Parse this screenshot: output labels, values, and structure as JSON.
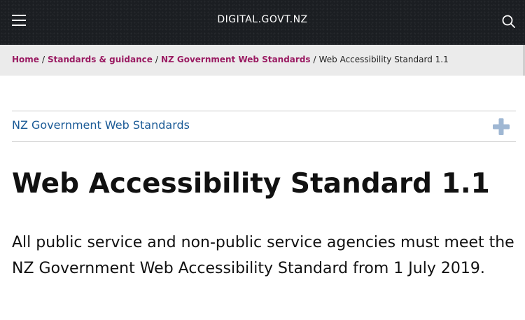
{
  "header": {
    "site_title": "DIGITAL.GOVT.NZ",
    "menu_icon": "hamburger-menu-icon",
    "search_icon": "search-icon"
  },
  "breadcrumb": {
    "items": [
      {
        "label": "Home"
      },
      {
        "label": "Standards & guidance"
      },
      {
        "label": "NZ Government Web Standards"
      }
    ],
    "separator": "/",
    "current": "Web Accessibility Standard 1.1"
  },
  "section_nav": {
    "label": "NZ Government Web Standards",
    "expand_icon": "plus-icon"
  },
  "main": {
    "title": "Web Accessibility Standard 1.1",
    "intro": "All public service and non-public service agencies must meet the NZ Government Web Accessibility Standard from 1 July 2019."
  },
  "colors": {
    "header_bg": "#1b1e22",
    "breadcrumb_bg": "#ebebeb",
    "breadcrumb_link": "#9a1b62",
    "section_link": "#1a5a96",
    "plus_icon": "#9fb7d3"
  }
}
